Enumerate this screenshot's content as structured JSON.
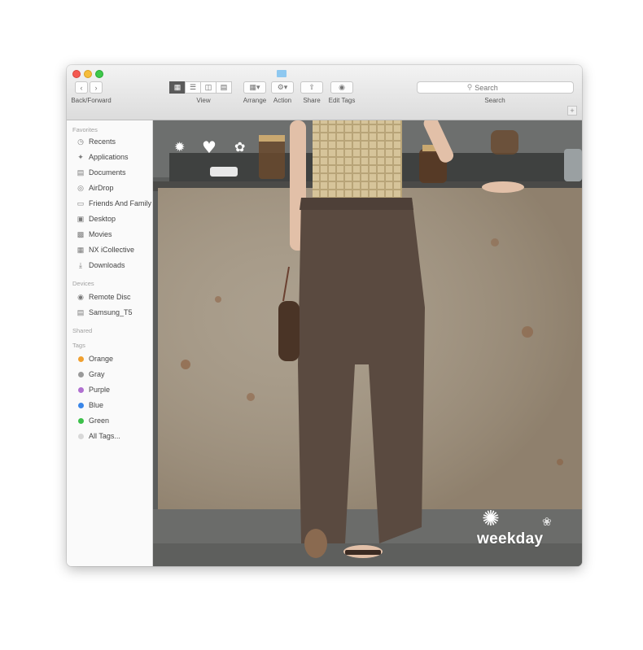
{
  "toolbar": {
    "back_forward_label": "Back/Forward",
    "view_label": "View",
    "arrange_label": "Arrange",
    "action_label": "Action",
    "share_label": "Share",
    "edit_tags_label": "Edit Tags",
    "search_label": "Search",
    "search_placeholder": "Search"
  },
  "sidebar": {
    "favorites_header": "Favorites",
    "favorites": [
      {
        "label": "Recents",
        "icon": "clock-icon"
      },
      {
        "label": "Applications",
        "icon": "applications-icon"
      },
      {
        "label": "Documents",
        "icon": "documents-icon"
      },
      {
        "label": "AirDrop",
        "icon": "airdrop-icon"
      },
      {
        "label": "Friends And Family",
        "icon": "folder-icon"
      },
      {
        "label": "Desktop",
        "icon": "desktop-icon"
      },
      {
        "label": "Movies",
        "icon": "movies-icon"
      },
      {
        "label": "NX iCollective",
        "icon": "document-icon"
      },
      {
        "label": "Downloads",
        "icon": "downloads-icon"
      }
    ],
    "devices_header": "Devices",
    "devices": [
      {
        "label": "Remote Disc",
        "icon": "disc-icon"
      },
      {
        "label": "Samsung_T5",
        "icon": "drive-icon"
      }
    ],
    "shared_header": "Shared",
    "tags_header": "Tags",
    "tags": [
      {
        "label": "Orange",
        "color": "#f0a030"
      },
      {
        "label": "Gray",
        "color": "#9a9a9a"
      },
      {
        "label": "Purple",
        "color": "#b070d0"
      },
      {
        "label": "Blue",
        "color": "#3a86e8"
      },
      {
        "label": "Green",
        "color": "#3cc04a"
      },
      {
        "label": "All Tags...",
        "color": "#d8d8d8"
      }
    ]
  },
  "content": {
    "brand_text": "weekday"
  }
}
